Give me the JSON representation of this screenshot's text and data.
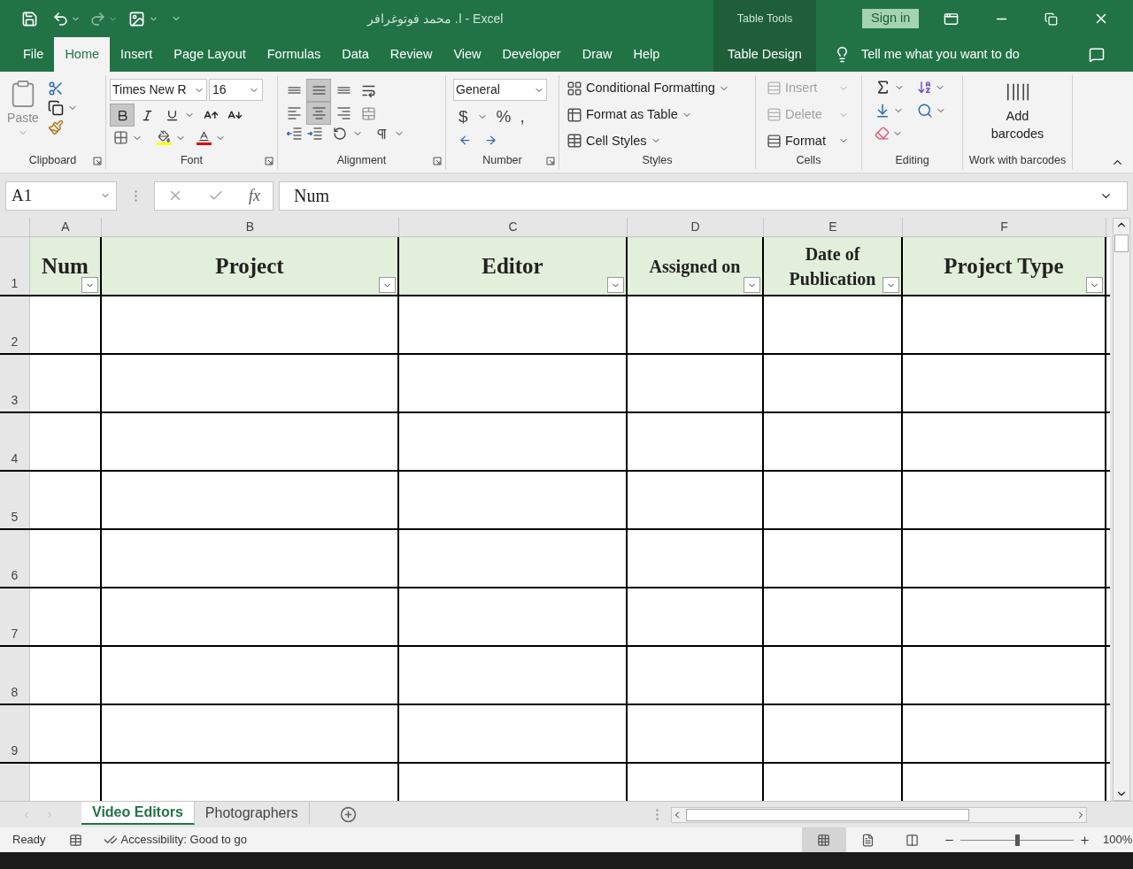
{
  "title_bar": {
    "title": "ا. محمد فوتوغرافر  -  Excel",
    "contextual": "Table Tools",
    "sign_in": "Sign in"
  },
  "tabs": [
    {
      "label": "File",
      "selected": false
    },
    {
      "label": "Home",
      "selected": true
    },
    {
      "label": "Insert",
      "selected": false
    },
    {
      "label": "Page Layout",
      "selected": false
    },
    {
      "label": "Formulas",
      "selected": false
    },
    {
      "label": "Data",
      "selected": false
    },
    {
      "label": "Review",
      "selected": false
    },
    {
      "label": "View",
      "selected": false
    },
    {
      "label": "Developer",
      "selected": false
    },
    {
      "label": "Draw",
      "selected": false
    },
    {
      "label": "Help",
      "selected": false
    }
  ],
  "contextual_tab": {
    "label": "Table Design",
    "selected": false
  },
  "tell_me": "Tell me what you want to do",
  "ribbon": {
    "clipboard": {
      "label": "Clipboard",
      "paste": "Paste"
    },
    "font": {
      "label": "Font",
      "font_name": "Times New R",
      "font_size": "16",
      "bold": true,
      "italic": false,
      "underline": false
    },
    "alignment": {
      "label": "Alignment",
      "vertical": [
        {
          "kind": "top",
          "selected": false
        },
        {
          "kind": "middle",
          "selected": true
        },
        {
          "kind": "bottom",
          "selected": false
        }
      ],
      "horizontal": [
        {
          "kind": "left",
          "selected": false
        },
        {
          "kind": "center",
          "selected": true
        },
        {
          "kind": "right",
          "selected": false
        }
      ]
    },
    "number": {
      "label": "Number",
      "format": "General",
      "symbols": [
        "$",
        "%",
        ","
      ]
    },
    "styles": {
      "label": "Styles",
      "items": [
        "Conditional Formatting",
        "Format as Table",
        "Cell Styles"
      ]
    },
    "cells": {
      "label": "Cells",
      "items": [
        {
          "label": "Insert",
          "disabled": true
        },
        {
          "label": "Delete",
          "disabled": true
        },
        {
          "label": "Format",
          "disabled": false
        }
      ]
    },
    "editing": {
      "label": "Editing"
    },
    "barcodes": {
      "label": "Work with barcodes",
      "button": "Add barcodes"
    }
  },
  "formula_bar": {
    "name_box": "A1",
    "fx": "fx",
    "value": "Num"
  },
  "sheet": {
    "columns": [
      "A",
      "B",
      "C",
      "D",
      "E",
      "F"
    ],
    "headers": [
      "Num",
      "Project",
      "Editor",
      "Assigned on",
      "Date of Publication",
      "Project Type"
    ],
    "header_row": "1",
    "rows": [
      "2",
      "3",
      "4",
      "5",
      "6",
      "7",
      "8",
      "9"
    ]
  },
  "sheet_tabs": [
    {
      "label": "Video Editors",
      "selected": true
    },
    {
      "label": "Photographers",
      "selected": false
    }
  ],
  "status_bar": {
    "ready": "Ready",
    "accessibility": "Accessibility: Good to go",
    "views": [
      {
        "kind": "normal",
        "selected": true
      },
      {
        "kind": "page_layout",
        "selected": false
      },
      {
        "kind": "page_break",
        "selected": false
      }
    ],
    "zoom": {
      "level": 0.5
    },
    "zoom_text": "100%"
  }
}
